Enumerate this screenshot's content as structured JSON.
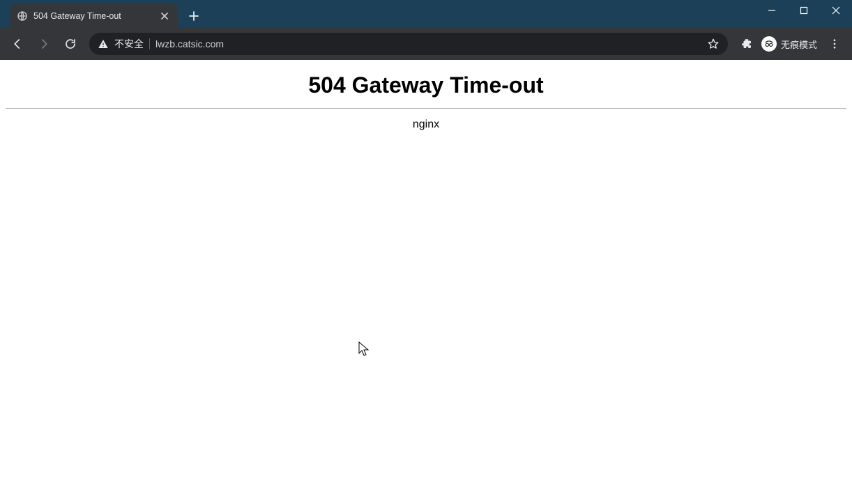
{
  "window": {
    "controls": {
      "minimize": "minimize",
      "maximize": "maximize",
      "close": "close"
    }
  },
  "tabstrip": {
    "tabs": [
      {
        "title": "504 Gateway Time-out",
        "favicon": "globe-icon"
      }
    ],
    "newtab_icon": "plus-icon"
  },
  "toolbar": {
    "back_icon": "arrow-left-icon",
    "forward_icon": "arrow-right-icon",
    "reload_icon": "reload-icon",
    "omnibox": {
      "security_icon": "warning-triangle-icon",
      "security_text": "不安全",
      "url": "lwzb.catsic.com",
      "star_icon": "star-icon"
    },
    "extensions_icon": "puzzle-icon",
    "incognito": {
      "label": "无痕模式",
      "icon": "incognito-icon"
    },
    "menu_icon": "dots-vertical-icon"
  },
  "page": {
    "heading": "504 Gateway Time-out",
    "server": "nginx"
  }
}
